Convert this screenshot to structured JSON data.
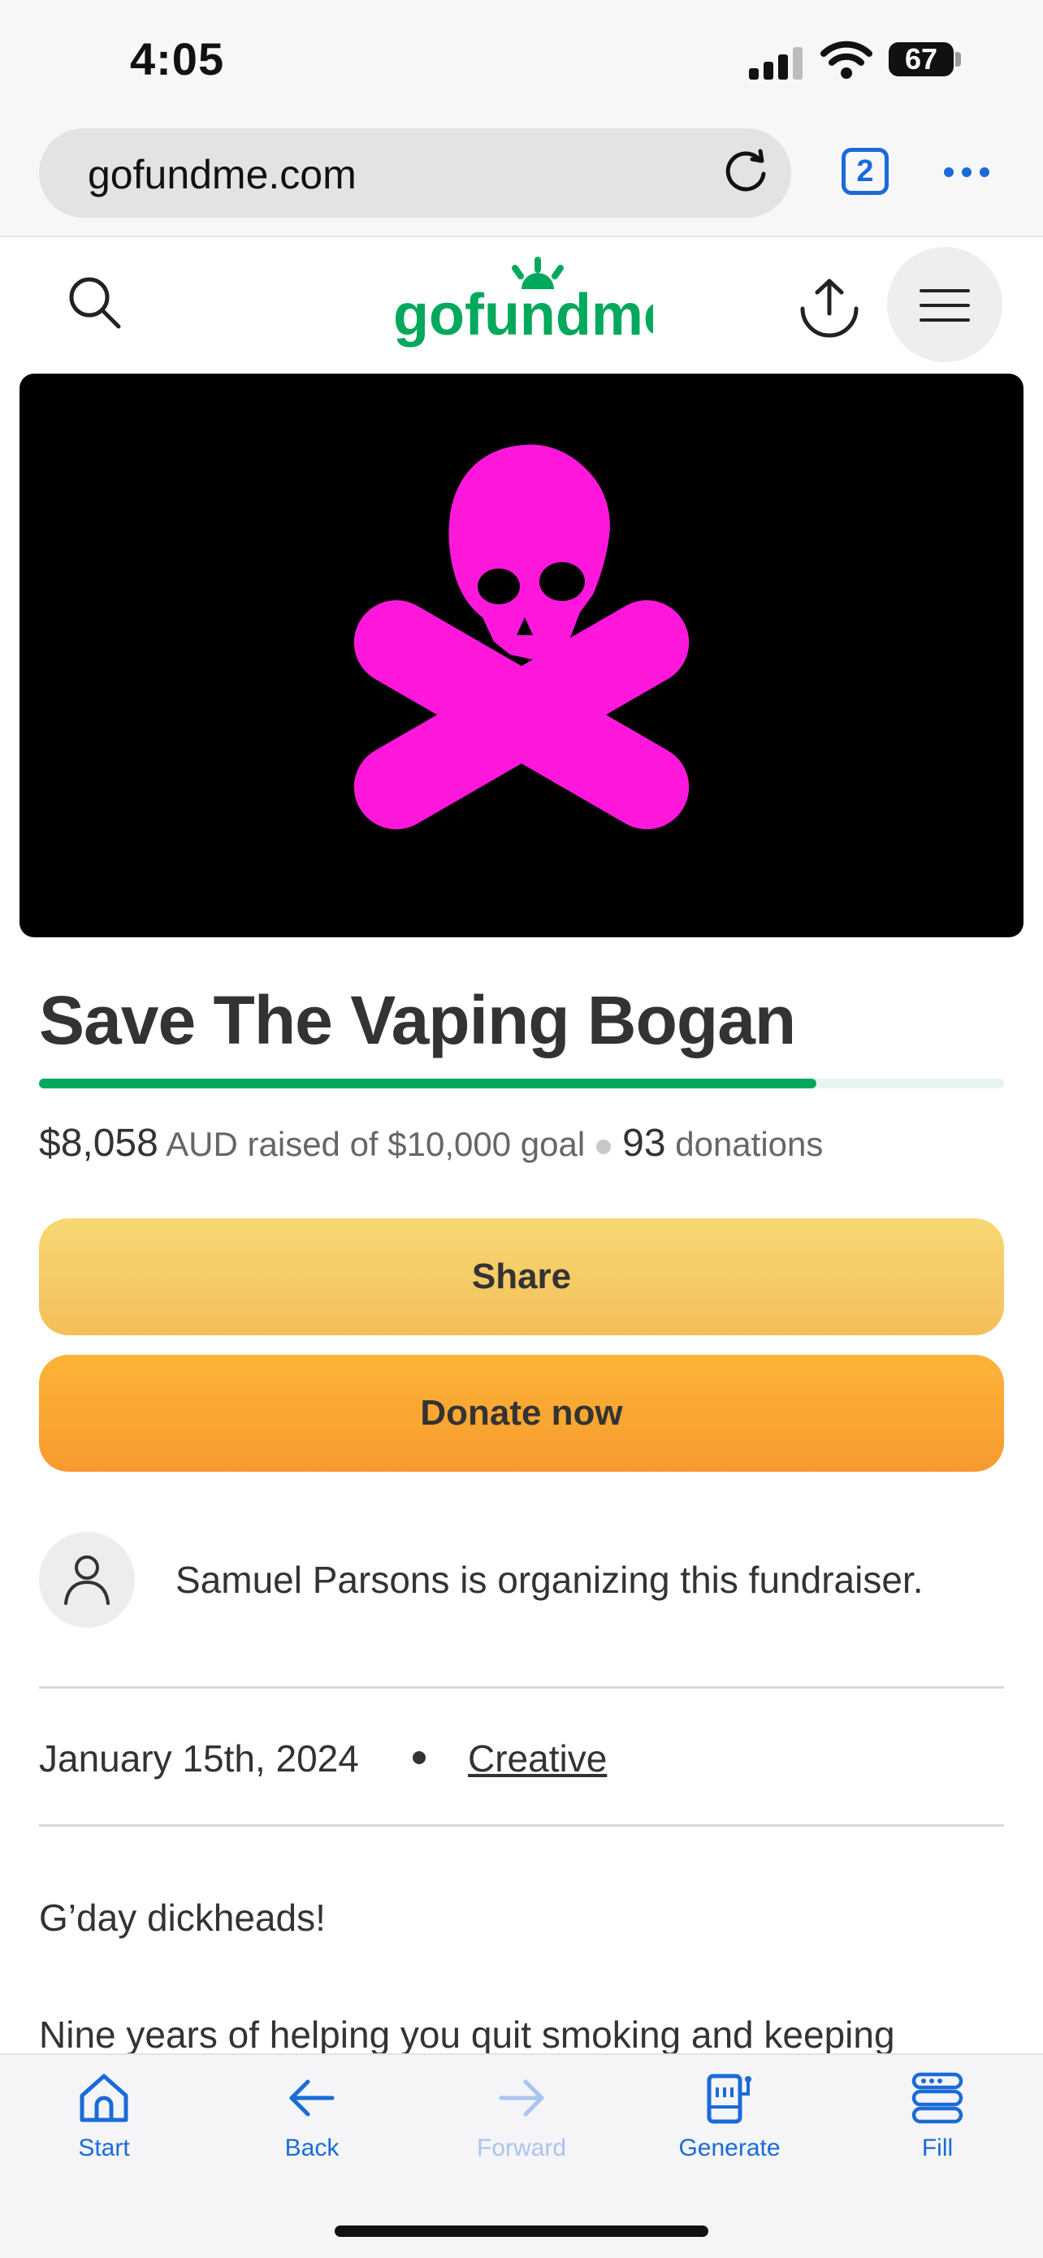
{
  "status_bar": {
    "time": "4:05",
    "battery": "67"
  },
  "browser": {
    "url": "gofundme.com",
    "tab_count": "2"
  },
  "site": {
    "logo_text": "gofundme",
    "brand_color": "#02a95c"
  },
  "campaign": {
    "title": "Save The Vaping Bogan",
    "progress_fraction": 0.8058,
    "raised_amount": "$8,058",
    "raised_text": "AUD raised of $10,000 goal",
    "donations_count": "93",
    "donations_label": "donations",
    "share_label": "Share",
    "donate_label": "Donate now",
    "organizer_text": "Samuel Parsons is organizing this fundraiser.",
    "date": "January 15th, 2024",
    "category": "Creative",
    "story_lines": [
      "G’day dickheads!",
      "Nine years of helping you quit smoking and keeping"
    ]
  },
  "toolbar": {
    "items": [
      {
        "label": "Start",
        "icon": "home-icon",
        "enabled": true
      },
      {
        "label": "Back",
        "icon": "arrow-left-icon",
        "enabled": true
      },
      {
        "label": "Forward",
        "icon": "arrow-right-icon",
        "enabled": false
      },
      {
        "label": "Generate",
        "icon": "generate-icon",
        "enabled": true
      },
      {
        "label": "Fill",
        "icon": "fill-icon",
        "enabled": true
      }
    ]
  },
  "colors": {
    "hero_skull": "#ff18dc",
    "link_blue": "#1a6bd8"
  }
}
